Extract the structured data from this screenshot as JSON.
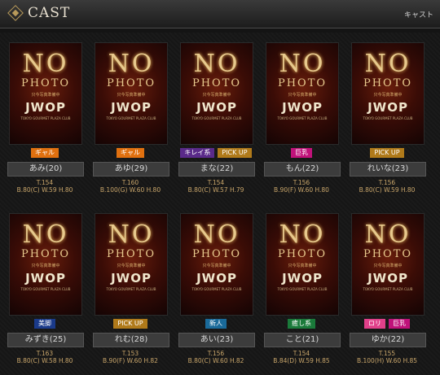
{
  "header": {
    "title": "CAST",
    "subtitle": "キャスト"
  },
  "placeholder": {
    "no": "NO",
    "photo": "PHOTO",
    "small": "只今写真準備中",
    "logo": "JWOP",
    "logo_sub": "TOKYO GOURMET PLAZA CLUB"
  },
  "tag_colors": {
    "gal": "#e0700f",
    "kirei": "#5a2a8a",
    "pickup": "#b07a1a",
    "kyonyu": "#c0127a",
    "bikyaku": "#1a3a8a",
    "shinjin": "#1a6a9a",
    "iyashi": "#1a7a3a",
    "loli": "#e0408a"
  },
  "casts": [
    {
      "name": "あみ(20)",
      "tags": [
        {
          "label": "ギャル",
          "color": "gal"
        }
      ],
      "height": "T.154",
      "measurements": "B.80(C) W.59 H.80"
    },
    {
      "name": "あゆ(29)",
      "tags": [
        {
          "label": "ギャル",
          "color": "gal"
        }
      ],
      "height": "T.160",
      "measurements": "B.100(G) W.60 H.80"
    },
    {
      "name": "まな(22)",
      "tags": [
        {
          "label": "キレイ系",
          "color": "kirei"
        },
        {
          "label": "PICK UP",
          "color": "pickup"
        }
      ],
      "height": "T.154",
      "measurements": "B.80(C) W.57 H.79"
    },
    {
      "name": "もん(22)",
      "tags": [
        {
          "label": "巨乳",
          "color": "kyonyu"
        }
      ],
      "height": "T.156",
      "measurements": "B.90(F) W.60 H.80"
    },
    {
      "name": "れいな(23)",
      "tags": [
        {
          "label": "PICK UP",
          "color": "pickup"
        }
      ],
      "height": "T.156",
      "measurements": "B.80(C) W.59 H.80"
    },
    {
      "name": "みずき(25)",
      "tags": [
        {
          "label": "美脚",
          "color": "bikyaku"
        }
      ],
      "height": "T.163",
      "measurements": "B.80(C) W.58 H.80"
    },
    {
      "name": "れむ(28)",
      "tags": [
        {
          "label": "PICK UP",
          "color": "pickup"
        }
      ],
      "height": "T.153",
      "measurements": "B.90(F) W.60 H.82"
    },
    {
      "name": "あい(23)",
      "tags": [
        {
          "label": "新人",
          "color": "shinjin"
        }
      ],
      "height": "T.156",
      "measurements": "B.80(C) W.60 H.82"
    },
    {
      "name": "こと(21)",
      "tags": [
        {
          "label": "癒し系",
          "color": "iyashi"
        }
      ],
      "height": "T.154",
      "measurements": "B.84(D) W.59 H.85"
    },
    {
      "name": "ゆか(22)",
      "tags": [
        {
          "label": "ロリ",
          "color": "loli"
        },
        {
          "label": "巨乳",
          "color": "kyonyu"
        }
      ],
      "height": "T.155",
      "measurements": "B.100(H) W.60 H.85"
    }
  ]
}
